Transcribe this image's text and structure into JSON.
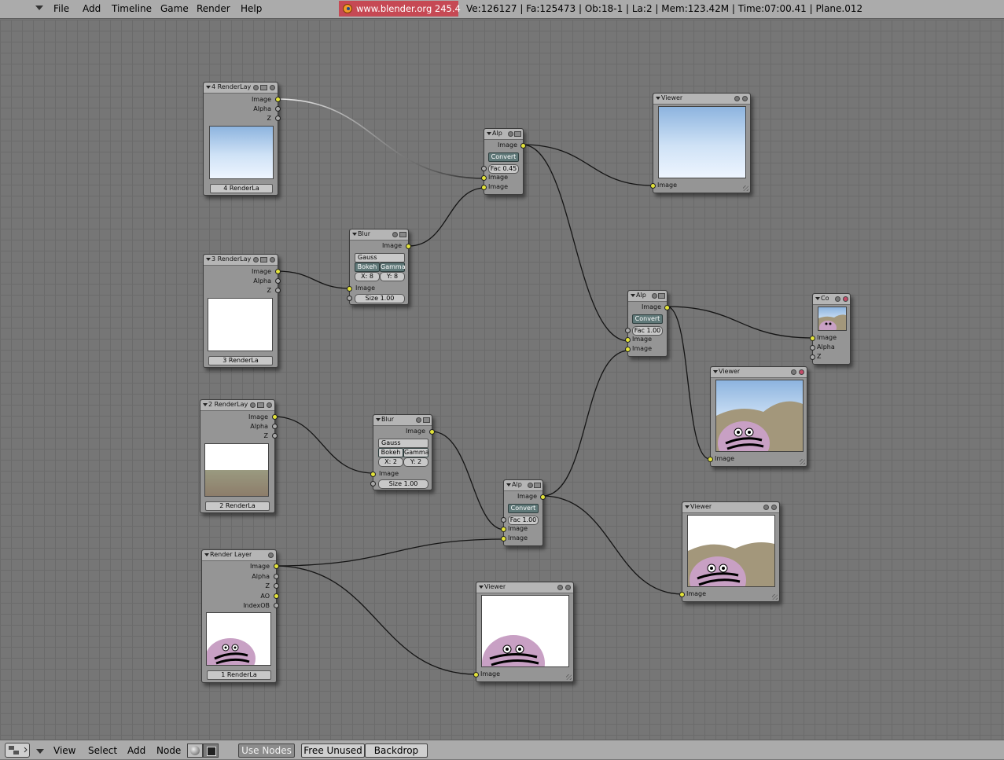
{
  "header": {
    "menus": [
      "File",
      "Add",
      "Timeline",
      "Game",
      "Render",
      "Help"
    ],
    "brand": "www.blender.org 245.4",
    "stats": "Ve:126127 | Fa:125473 | Ob:18-1 | La:2  | Mem:123.42M  | Time:07:00.41 | Plane.012"
  },
  "nodes": {
    "rl4": {
      "title": "4 RenderLay",
      "out_image": "Image",
      "out_alpha": "Alpha",
      "out_z": "Z",
      "layer": "4 RenderLa"
    },
    "rl3": {
      "title": "3 RenderLay",
      "out_image": "Image",
      "out_alpha": "Alpha",
      "out_z": "Z",
      "layer": "3 RenderLa"
    },
    "rl2": {
      "title": "2 RenderLay",
      "out_image": "Image",
      "out_alpha": "Alpha",
      "out_z": "Z",
      "layer": "2 RenderLa"
    },
    "rl1": {
      "title": "Render Layer",
      "out_image": "Image",
      "out_alpha": "Alpha",
      "out_z": "Z",
      "out_ao": "AO",
      "out_index": "IndexOB",
      "layer": "1 RenderLa"
    },
    "blur1": {
      "title": "Blur",
      "out_image": "Image",
      "filter": "Gauss",
      "bokeh": "Bokeh",
      "gamma": "Gamma",
      "x": "X: 8",
      "y": "Y: 8",
      "in_image": "Image",
      "size": "Size 1.00"
    },
    "blur2": {
      "title": "Blur",
      "out_image": "Image",
      "filter": "Gauss",
      "bokeh": "Bokeh",
      "gamma": "Gamma",
      "x": "X: 2",
      "y": "Y: 2",
      "in_image": "Image",
      "size": "Size 1.00"
    },
    "alp1": {
      "title": "Alp",
      "out_image": "Image",
      "convert": "Convert",
      "fac": "Fac 0.45",
      "in1": "Image",
      "in2": "Image"
    },
    "alp2": {
      "title": "Alp",
      "out_image": "Image",
      "convert": "Convert",
      "fac": "Fac 1.00",
      "in1": "Image",
      "in2": "Image"
    },
    "alp3": {
      "title": "Alp",
      "out_image": "Image",
      "convert": "Convert",
      "fac": "Fac 1.00",
      "in1": "Image",
      "in2": "Image"
    },
    "view1": {
      "title": "Viewer",
      "in_image": "Image"
    },
    "view2": {
      "title": "Viewer",
      "in_image": "Image"
    },
    "view3": {
      "title": "Viewer",
      "in_image": "Image"
    },
    "view4": {
      "title": "Viewer",
      "in_image": "Image"
    },
    "comp": {
      "title": "Co",
      "in_image": "Image",
      "in_alpha": "Alpha",
      "in_z": "Z"
    }
  },
  "footer": {
    "menus": [
      "View",
      "Select",
      "Add",
      "Node"
    ],
    "use_nodes": "Use Nodes",
    "free_unused": "Free Unused",
    "backdrop": "Backdrop"
  },
  "colors": {
    "socket_image": "#e3e33a",
    "socket_value": "#a8a8a8",
    "brand_bg": "#c64954",
    "canvas": "#767676"
  }
}
